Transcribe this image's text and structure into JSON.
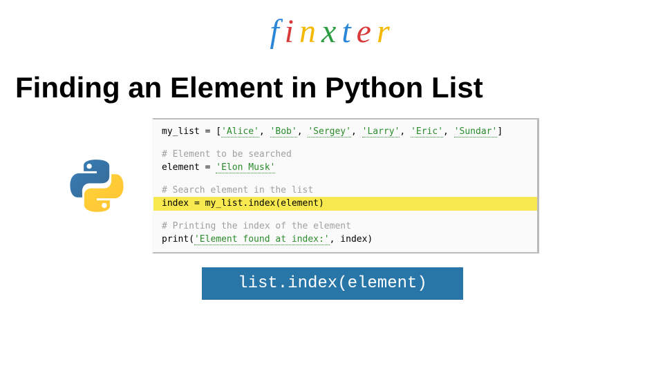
{
  "logo": {
    "letters": [
      {
        "char": "f",
        "class": "logo-f"
      },
      {
        "char": "i",
        "class": "logo-i"
      },
      {
        "char": "n",
        "class": "logo-n"
      },
      {
        "char": "x",
        "class": "logo-x"
      },
      {
        "char": "t",
        "class": "logo-t"
      },
      {
        "char": "e",
        "class": "logo-e"
      },
      {
        "char": "r",
        "class": "logo-r"
      }
    ]
  },
  "title": "Finding an Element in Python List",
  "code": {
    "line1_prefix": "my_list = [",
    "line1_strings": [
      "'Alice'",
      "'Bob'",
      "'Sergey'",
      "'Larry'",
      "'Eric'",
      "'Sundar'"
    ],
    "line1_sep": ", ",
    "line1_suffix": "]",
    "comment1": "# Element to be searched",
    "line2_prefix": "element = ",
    "line2_string": "'Elon Musk'",
    "comment2": "# Search element in the list",
    "line3": "index = my_list.index(element)",
    "comment3": "# Printing the index of the element",
    "line4_prefix": "print(",
    "line4_string": "'Element found at index:'",
    "line4_suffix": ", index)"
  },
  "method": "list.index(element)"
}
